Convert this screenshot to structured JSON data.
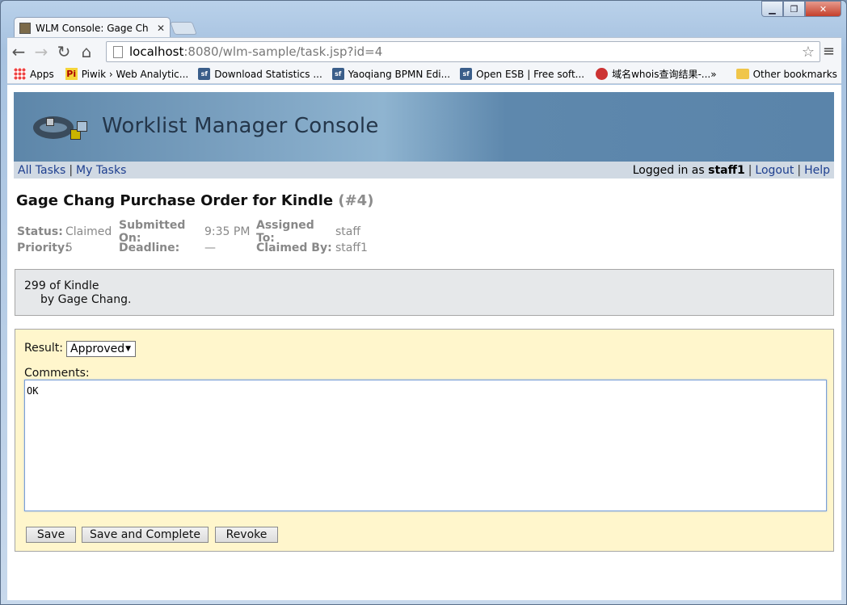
{
  "browser": {
    "tab_title": "WLM Console: Gage Chan",
    "tab_close": "✕",
    "url_host": "localhost",
    "url_path": ":8080/wlm-sample/task.jsp?id=4",
    "window_min": "▁",
    "window_max": "❐",
    "window_close": "✕"
  },
  "bookmarks": {
    "items": [
      {
        "label": "Apps",
        "icon": "apps-icon"
      },
      {
        "label": "Piwik › Web Analytic...",
        "icon": "piwik-icon"
      },
      {
        "label": "Download Statistics ...",
        "icon": "sourceforge-icon"
      },
      {
        "label": "Yaoqiang BPMN Edi...",
        "icon": "sourceforge-icon"
      },
      {
        "label": "Open ESB | Free soft...",
        "icon": "sourceforge-icon"
      },
      {
        "label": "域名whois查询结果-...",
        "icon": "whois-icon"
      }
    ],
    "overflow": "»",
    "other": "Other bookmarks",
    "sf_badge": "sf",
    "pi_badge": "Pi"
  },
  "app": {
    "banner_title": "Worklist Manager Console",
    "nav": {
      "all_tasks": "All Tasks",
      "sep": "|",
      "my_tasks": "My Tasks",
      "logged_in_prefix": "Logged in as",
      "user": "staff1",
      "logout": "Logout",
      "help": "Help"
    }
  },
  "task": {
    "title": "Gage Chang Purchase Order for Kindle",
    "number": "(#4)",
    "status_label": "Status:",
    "status_value": "Claimed",
    "priority_label": "Priority:",
    "priority_value": "5",
    "submitted_label": "Submitted On:",
    "submitted_value": "9:35 PM",
    "deadline_label": "Deadline:",
    "deadline_value": "—",
    "assigned_label": "Assigned To:",
    "assigned_value": "staff",
    "claimed_label": "Claimed By:",
    "claimed_value": "staff1",
    "description_line1": "299 of Kindle",
    "description_line2": "by Gage Chang."
  },
  "form": {
    "result_label": "Result:",
    "result_value": "Approved",
    "comments_label": "Comments:",
    "comments_value": "OK",
    "save": "Save",
    "save_complete": "Save and Complete",
    "revoke": "Revoke"
  }
}
